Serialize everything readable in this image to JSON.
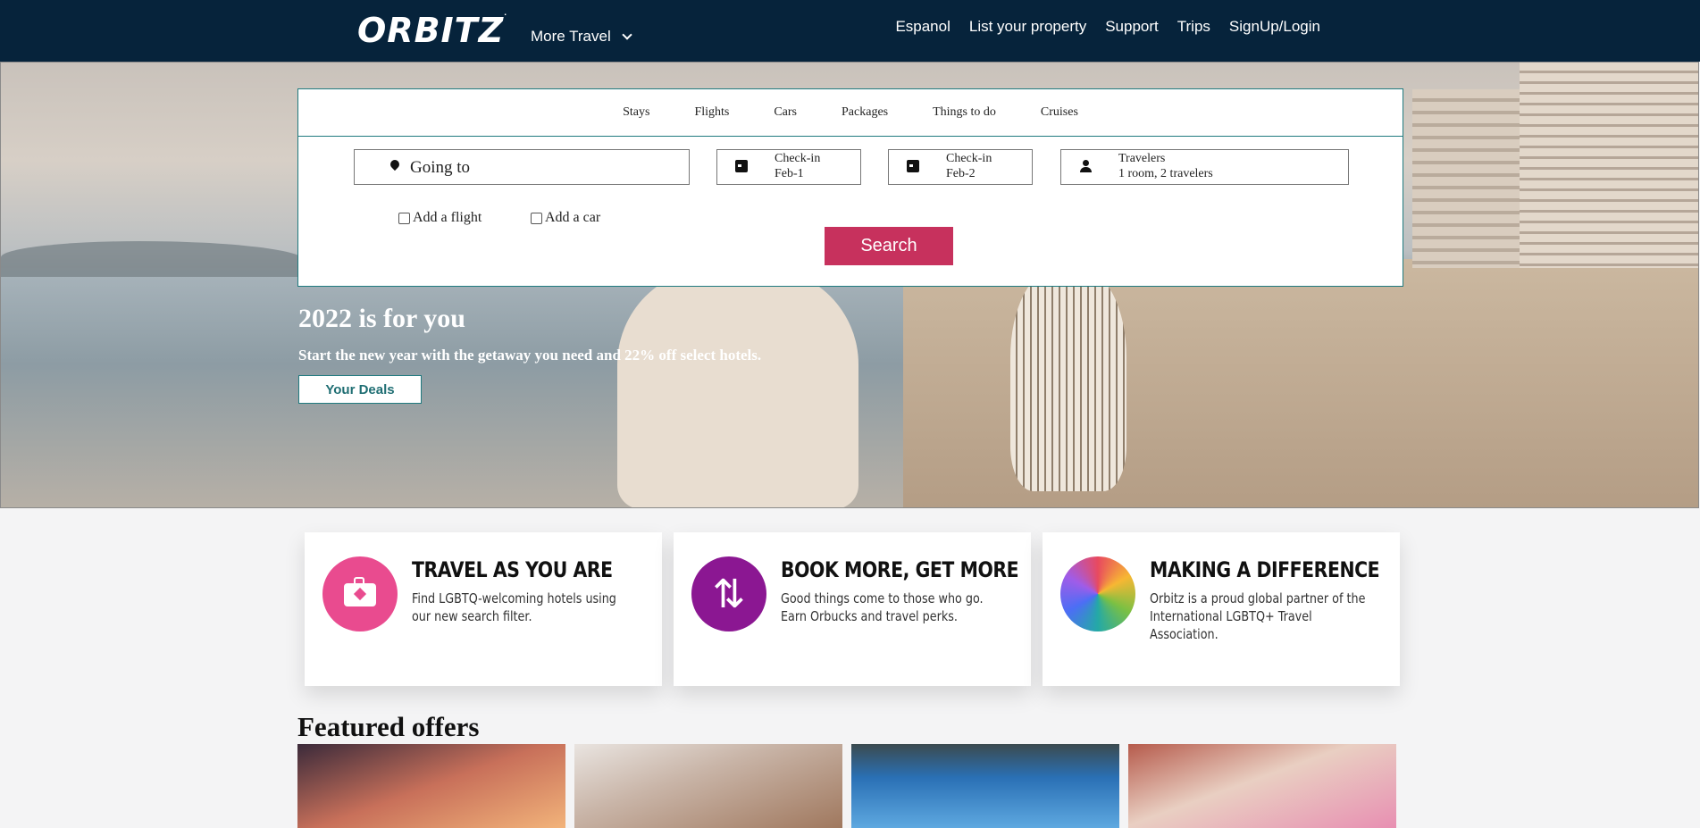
{
  "header": {
    "logo": "ORBITZ",
    "more_travel": "More Travel",
    "nav": [
      "Espanol",
      "List your property",
      "Support",
      "Trips",
      "SignUp/Login"
    ]
  },
  "search": {
    "tabs": [
      "Stays",
      "Flights",
      "Cars",
      "Packages",
      "Things to do",
      "Cruises"
    ],
    "going_to": "Going to",
    "checkin1_label": "Check-in",
    "checkin1_value": "Feb-1",
    "checkin2_label": "Check-in",
    "checkin2_value": "Feb-2",
    "travelers_label": "Travelers",
    "travelers_value": "1 room, 2 travelers",
    "add_flight": "Add a flight",
    "add_car": "Add a car",
    "search_button": "Search"
  },
  "hero": {
    "title": "2022 is for you",
    "subtitle": "Start the new year with the getaway you need and 22% off select hotels.",
    "deals_button": "Your Deals"
  },
  "promos": [
    {
      "title": "TRAVEL AS YOU ARE",
      "line1": "Find LGBTQ-welcoming hotels using",
      "line2": "our new search filter."
    },
    {
      "title": "BOOK MORE, GET MORE",
      "line1": "Good things come to those who go.",
      "line2": "Earn Orbucks and travel perks."
    },
    {
      "title": "MAKING A DIFFERENCE",
      "line1": "Orbitz is a proud global partner of the",
      "line2": "International LGBTQ+ Travel Association."
    }
  ],
  "featured_title": "Featured offers",
  "colors": {
    "header_bg": "#06233b",
    "accent_teal": "#1f7a7f",
    "search_button": "#c7315d",
    "promo_pink": "#e94b8f",
    "promo_purple": "#8b1792"
  }
}
